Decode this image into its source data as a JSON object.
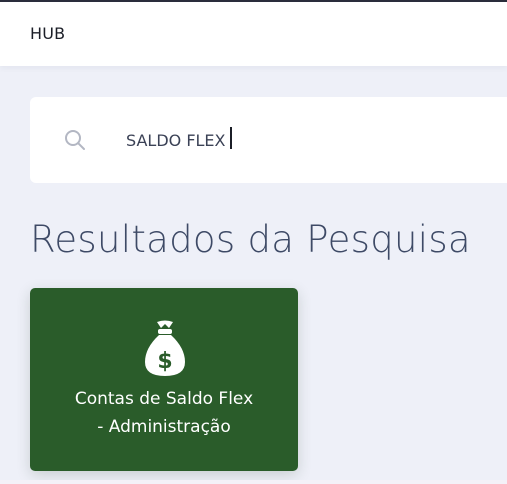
{
  "header": {
    "brand": "HUB"
  },
  "search": {
    "value": "SALDO FLEX",
    "icon": "search-icon"
  },
  "results": {
    "title": "Resultados da Pesquisa",
    "items": [
      {
        "line1": "Contas de Saldo Flex",
        "line2": "- Administração",
        "icon": "money-bag-icon",
        "color": "#2a5c2a"
      }
    ]
  },
  "colors": {
    "page_background": "#eef0f8",
    "card_green": "#2a5c2a",
    "title_text": "#3e4a66"
  }
}
